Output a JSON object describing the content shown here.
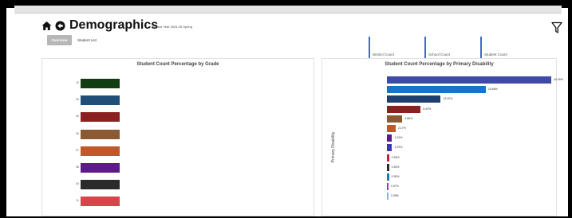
{
  "header": {
    "title": "Demographics",
    "school_year": "School Year 2024-25 Spring",
    "home_icon": "home-icon",
    "back_icon": "back-arrow-icon",
    "filter_icon": "filter-icon"
  },
  "tabs": [
    {
      "label": "Overview",
      "active": true
    },
    {
      "label": "Student List",
      "active": false
    }
  ],
  "kpis": [
    {
      "label": "District Count"
    },
    {
      "label": "School Count"
    },
    {
      "label": "Student Count"
    }
  ],
  "colors": {
    "accent": "#3b6cc9",
    "tab_active": "#b7b7b7"
  },
  "chart_data": [
    {
      "type": "bar",
      "orientation": "horizontal",
      "title": "Student Count Percentage by Grade",
      "categories": [
        "10",
        "09",
        "05",
        "06",
        "07",
        "08",
        "04",
        "11"
      ],
      "values": [
        1,
        1,
        1,
        1,
        1,
        1,
        1,
        1
      ],
      "colors": [
        "#123d12",
        "#1f4e79",
        "#8b2020",
        "#8b5a33",
        "#c0582a",
        "#5c1a8b",
        "#2b2b2b",
        "#d9444a"
      ]
    },
    {
      "type": "bar",
      "orientation": "horizontal",
      "title": "Student Count Percentage by Primary Disability",
      "ylabel": "Primary Disability",
      "values": [
        40.99,
        24.66,
        13.42,
        8.43,
        3.86,
        2.17,
        1.29,
        1.29,
        0.53,
        0.53,
        0.53,
        0.37,
        0.08
      ],
      "labels": [
        "40.99%",
        "24.66%",
        "13.42%",
        "8.43%",
        "3.86%",
        "2.17%",
        "1.29%",
        "1.29%",
        "0.53%",
        "0.53%",
        "0.53%",
        "0.37%",
        "0.08%"
      ],
      "colors": [
        "#3f4aa8",
        "#1a73c9",
        "#1f3f6e",
        "#8b2020",
        "#8b5a33",
        "#c0582a",
        "#5c1a8b",
        "#3a3ab8",
        "#c0203a",
        "#2b2b2b",
        "#1a73c9",
        "#b030a0",
        "#7fb2e5"
      ]
    }
  ]
}
